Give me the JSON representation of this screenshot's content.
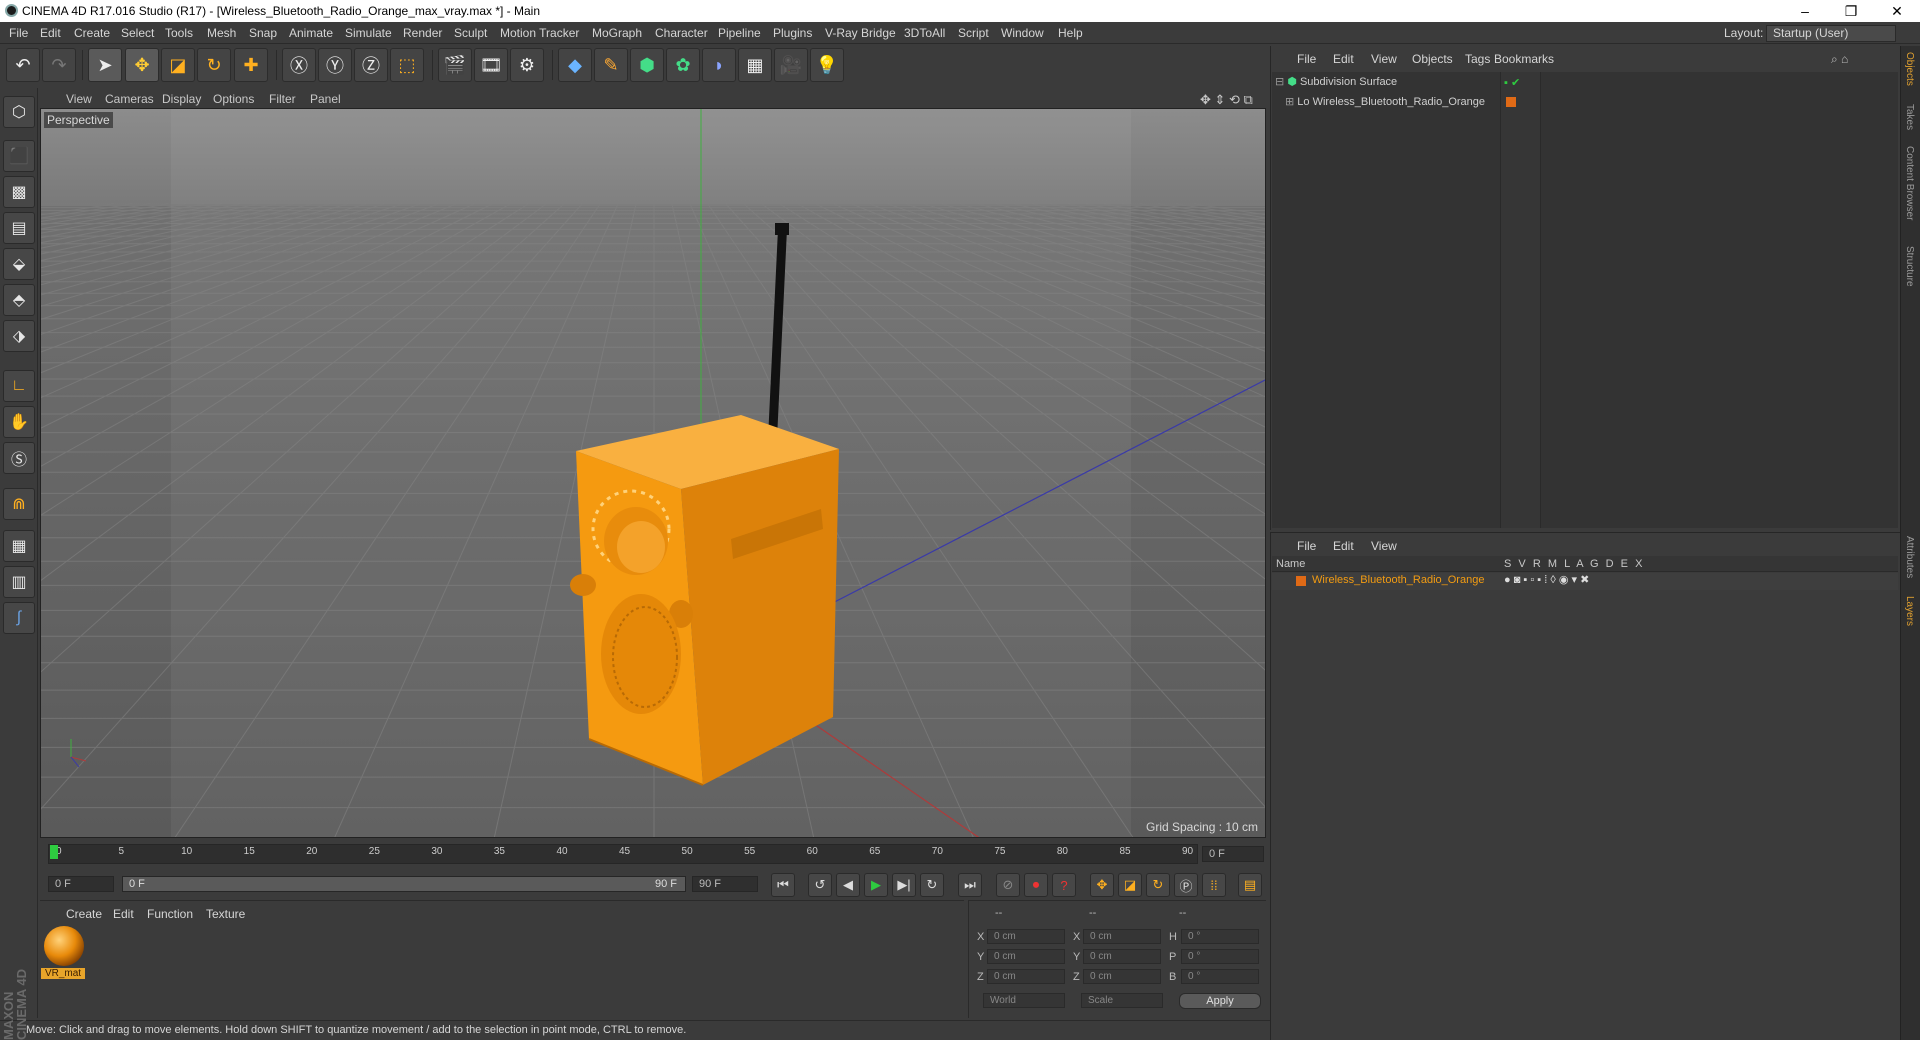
{
  "window": {
    "title": "CINEMA 4D R17.016 Studio (R17) - [Wireless_Bluetooth_Radio_Orange_max_vray.max *] - Main"
  },
  "menu": [
    "File",
    "Edit",
    "Create",
    "Select",
    "Tools",
    "Mesh",
    "Snap",
    "Animate",
    "Simulate",
    "Render",
    "Sculpt",
    "Motion Tracker",
    "MoGraph",
    "Character",
    "Pipeline",
    "Plugins",
    "V-Ray Bridge",
    "3DToAll",
    "Script",
    "Window",
    "Help"
  ],
  "layout": {
    "label": "Layout:",
    "value": "Startup (User)"
  },
  "viewport": {
    "menu": [
      "View",
      "Cameras",
      "Display",
      "Options",
      "Filter",
      "Panel"
    ],
    "label": "Perspective",
    "grid_spacing": "Grid Spacing : 10 cm"
  },
  "timeline": {
    "ticks": [
      "0",
      "5",
      "10",
      "15",
      "20",
      "25",
      "30",
      "35",
      "40",
      "45",
      "50",
      "55",
      "60",
      "65",
      "70",
      "75",
      "80",
      "85",
      "90"
    ],
    "current_frame": "0 F",
    "start": "0 F",
    "range_start": "0 F",
    "range_end": "90 F",
    "end": "90 F"
  },
  "material_panel": {
    "menu": [
      "Create",
      "Edit",
      "Function",
      "Texture"
    ],
    "material_name": "VR_mat"
  },
  "coordinates": {
    "headers": [
      "--",
      "--",
      "--"
    ],
    "rows": [
      {
        "a": "X",
        "av": "0 cm",
        "b": "X",
        "bv": "0 cm",
        "c": "H",
        "cv": "0 °"
      },
      {
        "a": "Y",
        "av": "0 cm",
        "b": "Y",
        "bv": "0 cm",
        "c": "P",
        "cv": "0 °"
      },
      {
        "a": "Z",
        "av": "0 cm",
        "b": "Z",
        "bv": "0 cm",
        "c": "B",
        "cv": "0 °"
      }
    ],
    "mode": "World",
    "type": "Scale",
    "apply": "Apply"
  },
  "objects_panel": {
    "menu": [
      "File",
      "Edit",
      "View",
      "Objects",
      "Tags",
      "Bookmarks"
    ],
    "items": [
      "Subdivision Surface",
      "Wireless_Bluetooth_Radio_Orange"
    ]
  },
  "layers_panel": {
    "menu": [
      "File",
      "Edit",
      "View"
    ],
    "header_name": "Name",
    "columns": [
      "S",
      "V",
      "R",
      "M",
      "L",
      "A",
      "G",
      "D",
      "E",
      "X"
    ],
    "layer": "Wireless_Bluetooth_Radio_Orange",
    "layer_color": "#e06a16"
  },
  "side_tabs": [
    "Objects",
    "Takes",
    "Content Browser",
    "Structure",
    "Attributes",
    "Layers"
  ],
  "status": "Move: Click and drag to move elements. Hold down SHIFT to quantize movement / add to the selection in point mode, CTRL to remove.",
  "brand": "MAXON CINEMA 4D",
  "colors": {
    "accent": "#f39c12",
    "radio": "#f59a10"
  }
}
